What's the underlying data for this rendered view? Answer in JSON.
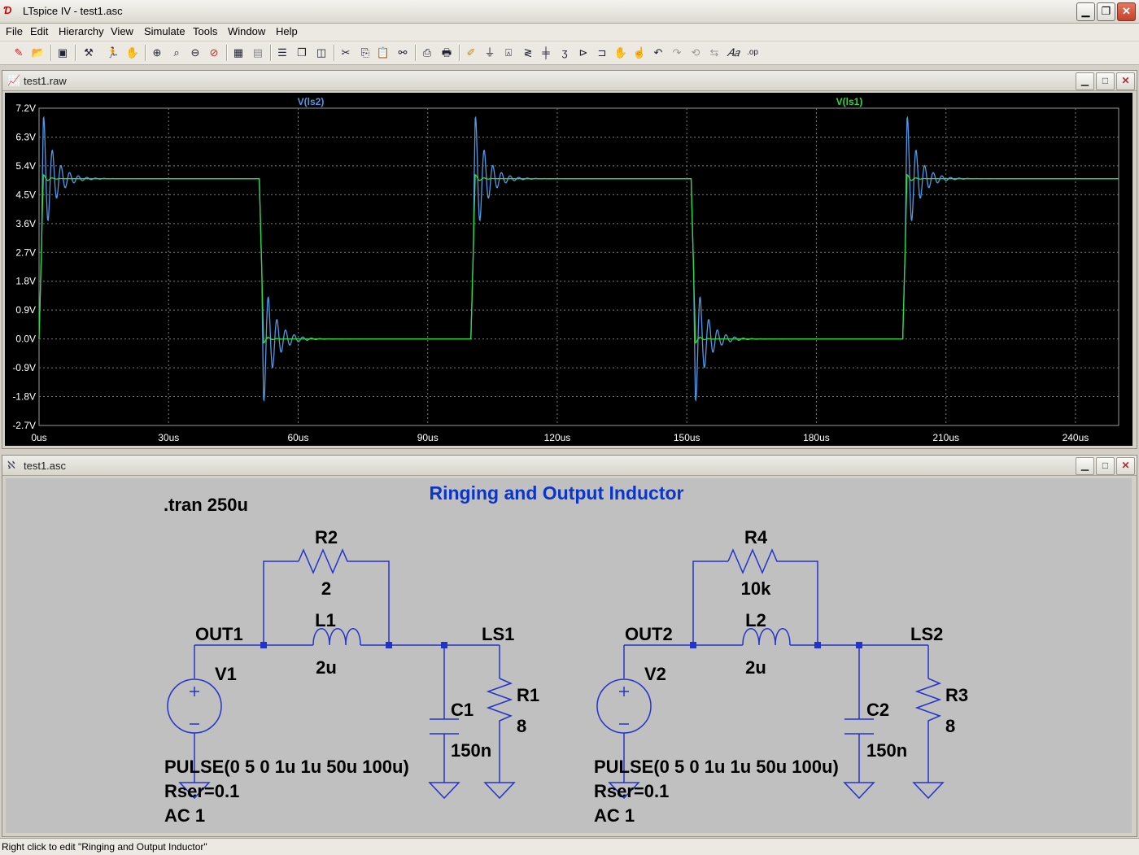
{
  "window": {
    "title": "LTspice IV - test1.asc",
    "min": "▁",
    "restore": "❐",
    "close": "✕"
  },
  "menu": [
    "File",
    "Edit",
    "Hierarchy",
    "View",
    "Simulate",
    "Tools",
    "Window",
    "Help"
  ],
  "plot_window": {
    "title": "test1.raw",
    "min": "▁",
    "restore": "□",
    "close": "✕"
  },
  "schematic_window": {
    "title": "test1.asc",
    "min": "▁",
    "restore": "□",
    "close": "✕"
  },
  "colors": {
    "plot_bg": "#000000",
    "grid": "#7a7a7a",
    "trace_ls2": "#4f9ae6",
    "trace_ls1": "#2ddd3c",
    "wire": "#2233cc",
    "schematic_bg": "#c0c0c0",
    "title_text": "#0b35c8"
  },
  "chart_data": {
    "type": "line",
    "series": [
      {
        "name": "V(ls2)",
        "color": "#4f9ae6"
      },
      {
        "name": "V(ls1)",
        "color": "#2ddd3c"
      }
    ],
    "x_ticks": [
      "0us",
      "30us",
      "60us",
      "90us",
      "120us",
      "150us",
      "180us",
      "210us",
      "240us"
    ],
    "y_ticks": [
      "7.2V",
      "6.3V",
      "5.4V",
      "4.5V",
      "3.6V",
      "2.7V",
      "1.8V",
      "0.9V",
      "0.0V",
      "-0.9V",
      "-1.8V",
      "-2.7V"
    ],
    "xlim": [
      0,
      250
    ],
    "ylim": [
      -2.7,
      7.2
    ],
    "grid": true,
    "legend_placement": "top",
    "pulse": {
      "low": 0,
      "high": 5,
      "delay": 0,
      "rise": 1,
      "fall": 1,
      "width": 50,
      "period": 100
    },
    "ls2_overshoot_peak": 6.8,
    "ls2_undershoot_peak": -1.9
  },
  "schematic": {
    "title": "Ringing and Output Inductor",
    "directive": ".tran 250u",
    "left": {
      "out": "OUT1",
      "ls": "LS1",
      "r_par": {
        "name": "R2",
        "value": "2"
      },
      "ind": {
        "name": "L1",
        "value": "2u"
      },
      "src": {
        "name": "V1"
      },
      "cap": {
        "name": "C1",
        "value": "150n"
      },
      "load": {
        "name": "R1",
        "value": "8"
      },
      "src_lines": [
        "PULSE(0 5 0 1u 1u 50u 100u)",
        "Rser=0.1",
        "AC 1"
      ]
    },
    "right": {
      "out": "OUT2",
      "ls": "LS2",
      "r_par": {
        "name": "R4",
        "value": "10k"
      },
      "ind": {
        "name": "L2",
        "value": "2u"
      },
      "src": {
        "name": "V2"
      },
      "cap": {
        "name": "C2",
        "value": "150n"
      },
      "load": {
        "name": "R3",
        "value": "8"
      },
      "src_lines": [
        "PULSE(0 5 0 1u 1u 50u 100u)",
        "Rser=0.1",
        "AC 1"
      ]
    }
  },
  "status": "Right click to edit \"Ringing and Output Inductor\""
}
